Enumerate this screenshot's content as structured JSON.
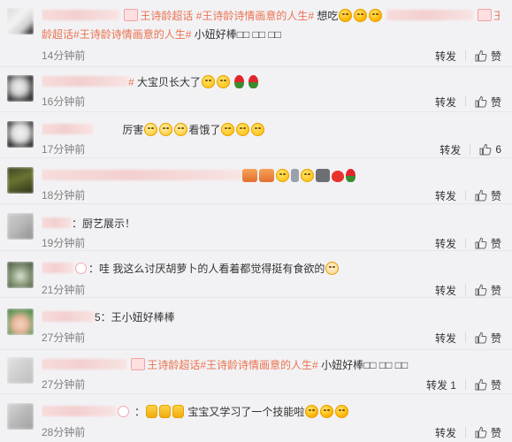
{
  "actions": {
    "repost_label": "转发",
    "like_label": "赞",
    "like_icon": "thumbs-up-icon"
  },
  "colors": {
    "background": "#f2f2f5",
    "topic": "#eb7350",
    "meta": "#808080",
    "divider": "#e6e6e6"
  },
  "comments": [
    {
      "name_masked": true,
      "topic_a": "王诗龄超话",
      "topic_b": "#王诗龄诗情画意的人生#",
      "text_a": "想吃",
      "tail_topic_a": "王诗",
      "tail_topic_b": "龄超话",
      "tail_topic_c": "#王诗龄诗情画意的人生#",
      "text_b": "小妞好棒□□ □□ □□",
      "time": "14分钟前",
      "repost": "转发",
      "like": "赞"
    },
    {
      "name_masked": true,
      "topic_a": "#",
      "text_a": "大宝贝长大了",
      "time": "16分钟前",
      "repost": "转发",
      "like": "赞"
    },
    {
      "name_masked": true,
      "text_a": "厉害",
      "text_b": "看饿了",
      "time": "17分钟前",
      "repost": "转发",
      "like": "6"
    },
    {
      "name_masked": true,
      "time": "18分钟前",
      "repost": "转发",
      "like": "赞"
    },
    {
      "name_masked": true,
      "text_a": "：厨艺展示！",
      "time": "19分钟前",
      "repost": "转发",
      "like": "赞"
    },
    {
      "name_masked": true,
      "text_a": "：哇 我这么讨厌胡萝卜的人看着都觉得挺有食欲的",
      "time": "21分钟前",
      "repost": "转发",
      "like": "赞"
    },
    {
      "name_masked": true,
      "text_a": "5：王小妞好棒棒",
      "time": "27分钟前",
      "repost": "转发",
      "like": "赞"
    },
    {
      "name_masked": true,
      "topic_a": "王诗龄超话",
      "topic_b": "#王诗龄诗情画意的人生#",
      "text_a": "小妞好棒□□ □□ □□",
      "time": "27分钟前",
      "repost": "转发 1",
      "like": "赞"
    },
    {
      "name_masked": true,
      "text_a": "宝宝又学习了一个技能啦",
      "time": "28分钟前",
      "repost": "转发",
      "like": "赞"
    }
  ]
}
